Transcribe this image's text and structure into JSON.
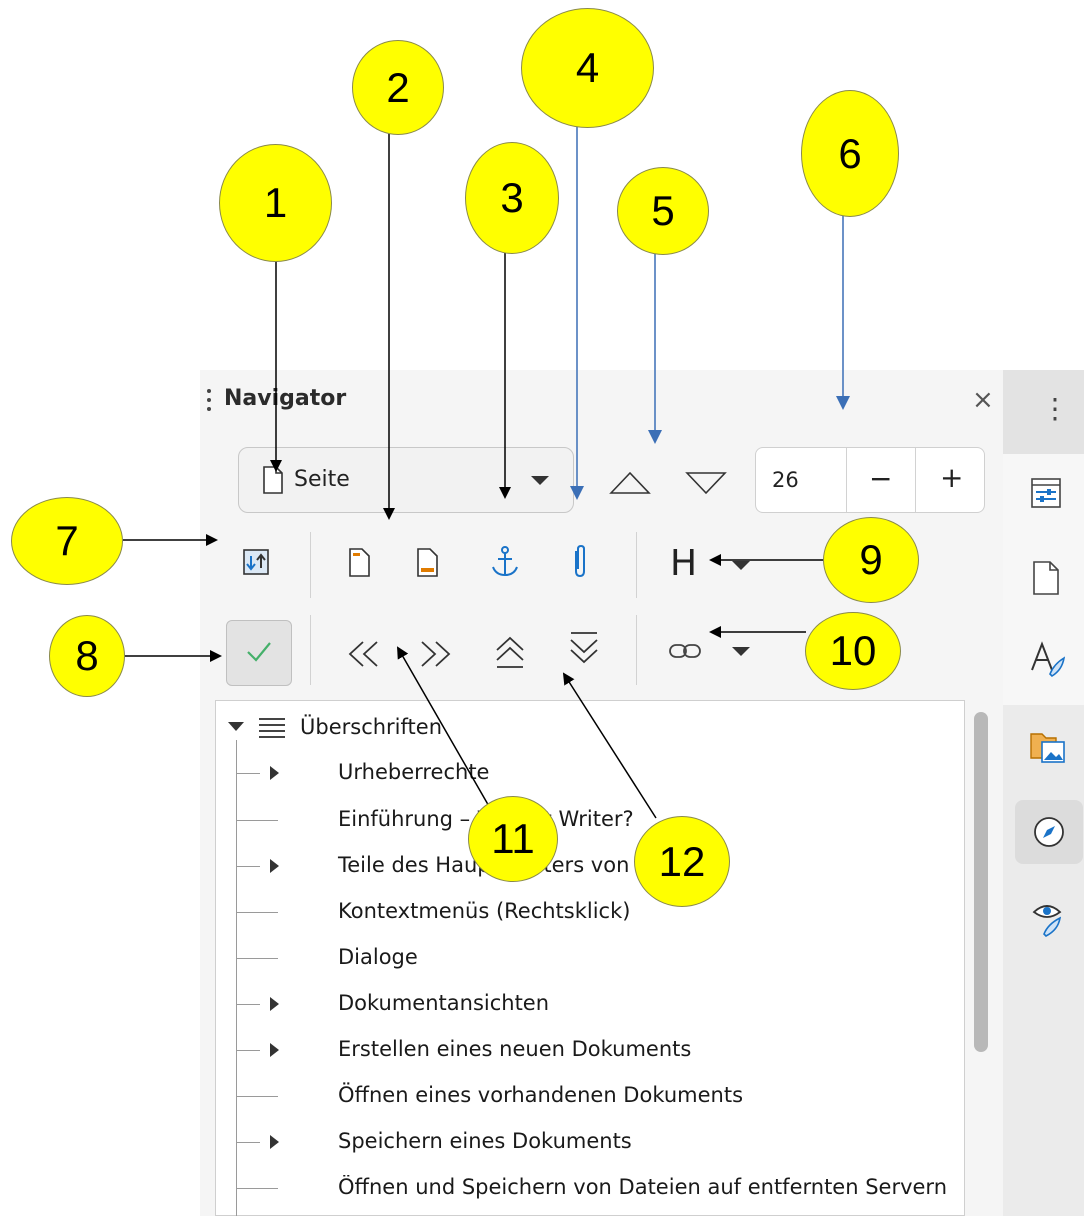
{
  "panel": {
    "title": "Navigator",
    "close_glyph": "×",
    "navigate_by": {
      "selected": "Seite"
    },
    "page_number": {
      "value": "26",
      "minus": "−",
      "plus": "+"
    },
    "headings_level_label": "H"
  },
  "tree": {
    "root_label": "Überschriften",
    "items": [
      {
        "label": "Urheberrechte",
        "expandable": true
      },
      {
        "label": "Einführung – Was ist Writer?",
        "expandable": false
      },
      {
        "label": "Teile des Hauptfensters von Writer",
        "expandable": true
      },
      {
        "label": "Kontextmenüs (Rechtsklick)",
        "expandable": false
      },
      {
        "label": "Dialoge",
        "expandable": false
      },
      {
        "label": "Dokumentansichten",
        "expandable": true
      },
      {
        "label": "Erstellen eines neuen Dokuments",
        "expandable": true
      },
      {
        "label": "Öffnen eines vorhandenen Dokuments",
        "expandable": false
      },
      {
        "label": "Speichern eines Dokuments",
        "expandable": true
      },
      {
        "label": "Öffnen und Speichern von Dateien auf entfernten Servern",
        "expandable": false
      }
    ]
  },
  "sidebar": {
    "menu_glyph": "⋮",
    "tabs": [
      "properties-icon",
      "page-icon",
      "styles-icon",
      "gallery-icon",
      "navigator-icon",
      "style-inspector-icon"
    ],
    "active_tab": "navigator-icon"
  },
  "callouts": [
    "1",
    "2",
    "3",
    "4",
    "5",
    "6",
    "7",
    "8",
    "9",
    "10",
    "11",
    "12"
  ],
  "colors": {
    "callout_fill": "#ffff00",
    "accent_blue": "#1a73c8",
    "arrow_blue": "#3b6fb6"
  }
}
